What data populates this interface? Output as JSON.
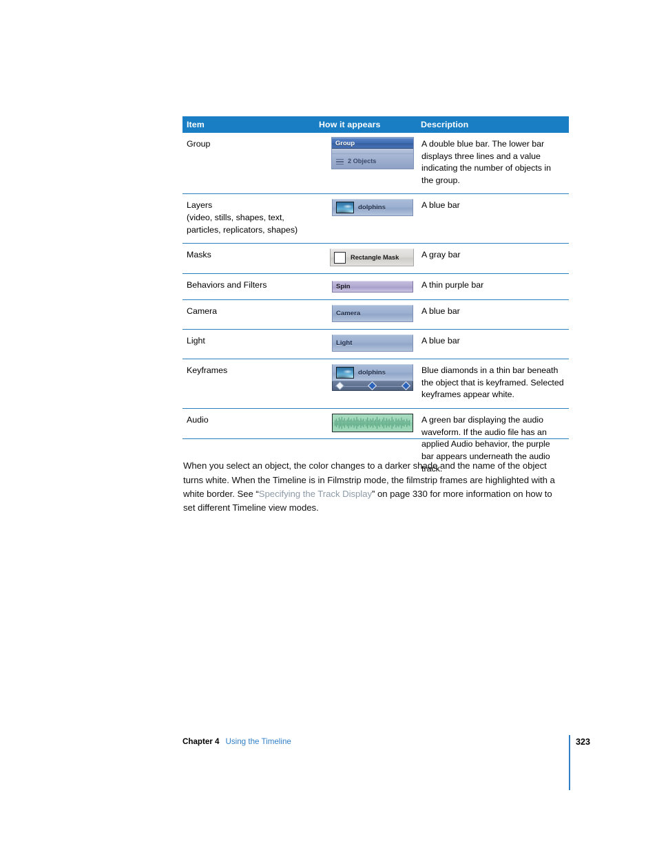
{
  "table": {
    "headers": [
      "Item",
      "How it appears",
      "Description"
    ],
    "rows": [
      {
        "item": "Group",
        "widget": "group-double-bar",
        "widget_labels": {
          "top": "Group",
          "bottom": "2 Objects"
        },
        "description": "A double blue bar. The lower bar displays three lines and a value indicating the number of objects in the group."
      },
      {
        "item": "Layers\n(video, stills, shapes, text,\nparticles, replicators, shapes)",
        "widget": "layer-blue-bar",
        "widget_labels": {
          "top": "dolphins"
        },
        "description": "A blue bar"
      },
      {
        "item": "Masks",
        "widget": "mask-gray-bar",
        "widget_labels": {
          "top": "Rectangle Mask"
        },
        "description": "A gray bar"
      },
      {
        "item": "Behaviors and Filters",
        "widget": "behavior-purple-bar",
        "widget_labels": {
          "top": "Spin"
        },
        "description": "A thin purple bar"
      },
      {
        "item": "Camera",
        "widget": "camera-blue-bar",
        "widget_labels": {
          "top": "Camera"
        },
        "description": "A blue bar"
      },
      {
        "item": "Light",
        "widget": "light-blue-bar",
        "widget_labels": {
          "top": "Light"
        },
        "description": "A blue bar"
      },
      {
        "item": "Keyframes",
        "widget": "keyframe-track",
        "widget_labels": {
          "top": "dolphins"
        },
        "description": "Blue diamonds in a thin bar beneath the object that is keyframed. Selected keyframes appear white."
      },
      {
        "item": "Audio",
        "widget": "audio-green-waveform",
        "widget_labels": {
          "top": ""
        },
        "description": "A green bar displaying the audio waveform. If the audio file has an applied Audio behavior, the purple bar appears underneath the audio track."
      }
    ]
  },
  "body": {
    "paragraph_part1": "When you select an object, the color changes to a darker shade and the name of the object turns white. When the Timeline is in Filmstrip mode, the filmstrip frames are highlighted with a white border. See “",
    "paragraph_link": "Specifying the Track Display",
    "paragraph_part2": "” on page 330 for more information on how to set different Timeline view modes."
  },
  "footer": {
    "chapter": "Chapter 4",
    "title": "Using the Timeline",
    "page_number": "323"
  },
  "colors": {
    "header_blue": "#1a7ec4",
    "rule_blue": "#2a7fbe",
    "link_blue": "#2f7fc8",
    "xref_gray": "#8d9aa6",
    "bar_blue": "#9cb0d0",
    "bar_gray": "#dddbd8",
    "bar_purple": "#b3abd2",
    "bar_green": "#9ad4b5",
    "keyframe_blue": "#2b63ba"
  }
}
